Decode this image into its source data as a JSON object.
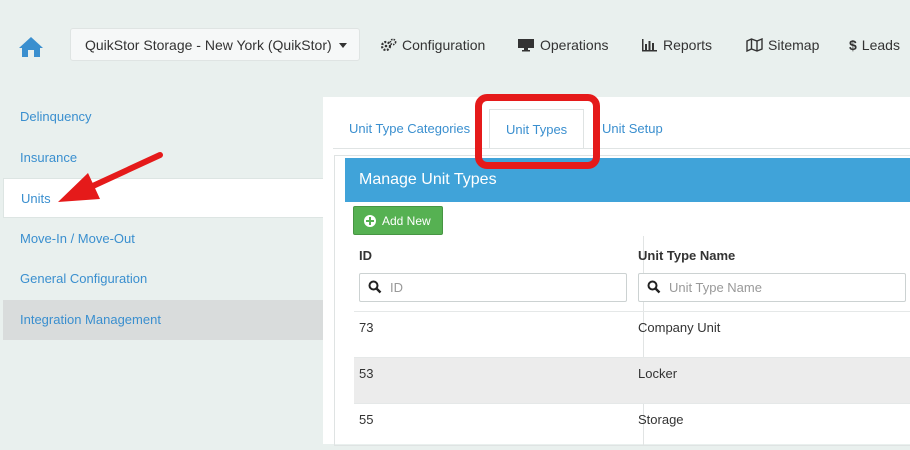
{
  "topnav": {
    "location_select": "QuikStor Storage - New York (QuikStor)",
    "items": [
      {
        "label": "Configuration",
        "icon": "gears-icon"
      },
      {
        "label": "Operations",
        "icon": "monitor-icon"
      },
      {
        "label": "Reports",
        "icon": "bar-chart-icon"
      },
      {
        "label": "Sitemap",
        "icon": "map-icon"
      },
      {
        "label": "Leads",
        "icon": "dollar-icon"
      }
    ]
  },
  "sidebar": {
    "items": [
      {
        "label": "Delinquency"
      },
      {
        "label": "Insurance"
      },
      {
        "label": "Units",
        "active": true
      },
      {
        "label": "Move-In / Move-Out"
      },
      {
        "label": "General Configuration"
      },
      {
        "label": "Integration Management"
      }
    ]
  },
  "tabs": [
    {
      "label": "Unit Type Categories"
    },
    {
      "label": "Unit Types",
      "active": true
    },
    {
      "label": "Unit Setup"
    }
  ],
  "panel": {
    "title": "Manage Unit Types",
    "add_button": "Add New",
    "columns": [
      "ID",
      "Unit Type Name"
    ],
    "filters": {
      "id_placeholder": "ID",
      "name_placeholder": "Unit Type Name"
    },
    "rows": [
      {
        "id": "73",
        "name": "Company Unit"
      },
      {
        "id": "53",
        "name": "Locker"
      },
      {
        "id": "55",
        "name": "Storage"
      }
    ]
  },
  "colors": {
    "accent": "#40a3d9",
    "link": "#3a8fcf",
    "button": "#56b152",
    "annotation": "#e51a1a"
  }
}
